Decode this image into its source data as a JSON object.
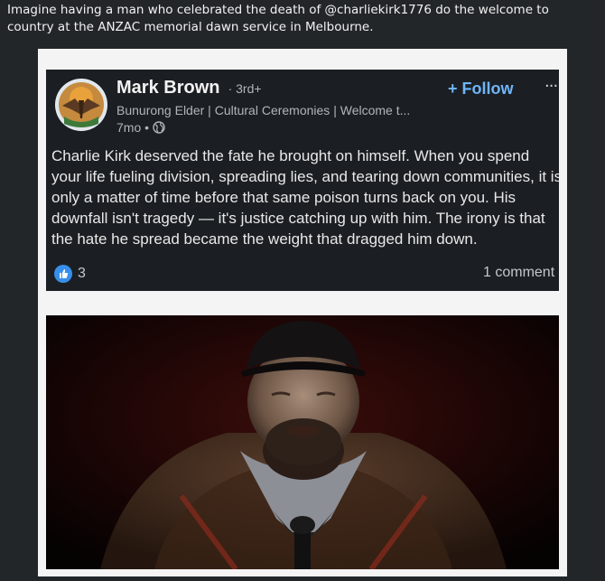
{
  "post": {
    "text": "Imagine having a man who celebrated the death of @charliekirk1776 do the welcome to country at the ANZAC memorial dawn service in Melbourne."
  },
  "card": {
    "author_name": "Mark Brown",
    "connection_degree": "· 3rd+",
    "headline": "Bunurong Elder | Cultural Ceremonies | Welcome t...",
    "time": "7mo •",
    "follow_label": "+ Follow",
    "more_label": "···",
    "body": "Charlie Kirk deserved the fate he brought on himself. When you spend your life fueling division, spreading lies, and tearing down communities, it is only a matter of time before that same poison turns back on you. His downfall isn't tragedy — it's justice catching up with him. The irony is that the hate he spread became the weight that dragged him down.",
    "reaction_count": "3",
    "comments_label": "1 comment"
  },
  "icons": [
    "globe-icon",
    "like-icon",
    "more-icon"
  ],
  "colors": {
    "background": "#232629",
    "card_background": "#1b1f23",
    "follow_accent": "#70b5f9",
    "like_accent": "#378fe9"
  }
}
